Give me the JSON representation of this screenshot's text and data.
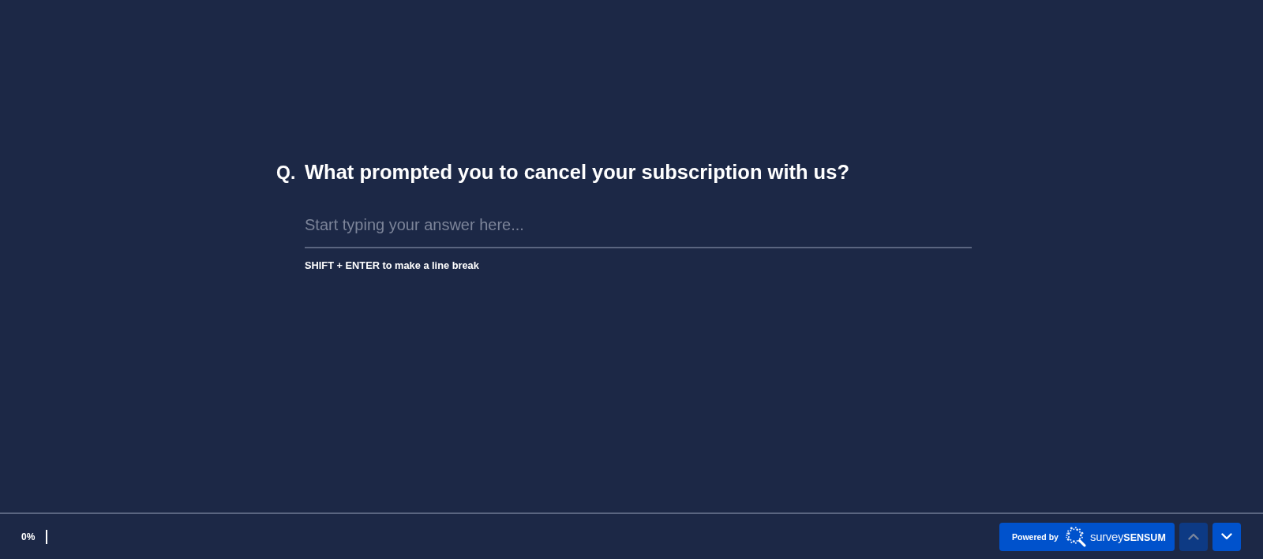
{
  "question": {
    "number": "Q.",
    "text": "What prompted you to cancel your subscription with us?"
  },
  "answer": {
    "placeholder": "Start typing your answer here...",
    "hint": "SHIFT + ENTER to make a line break"
  },
  "footer": {
    "progress": {
      "reading": "0%",
      "level": 0
    },
    "powered_by": {
      "label": "Powered by",
      "logo": "survey**SENSUM**"
    },
    "nav_buttons": [
      {
        "kind": "up",
        "disabled": true
      },
      {
        "kind": "down",
        "disabled": false
      }
    ]
  }
}
